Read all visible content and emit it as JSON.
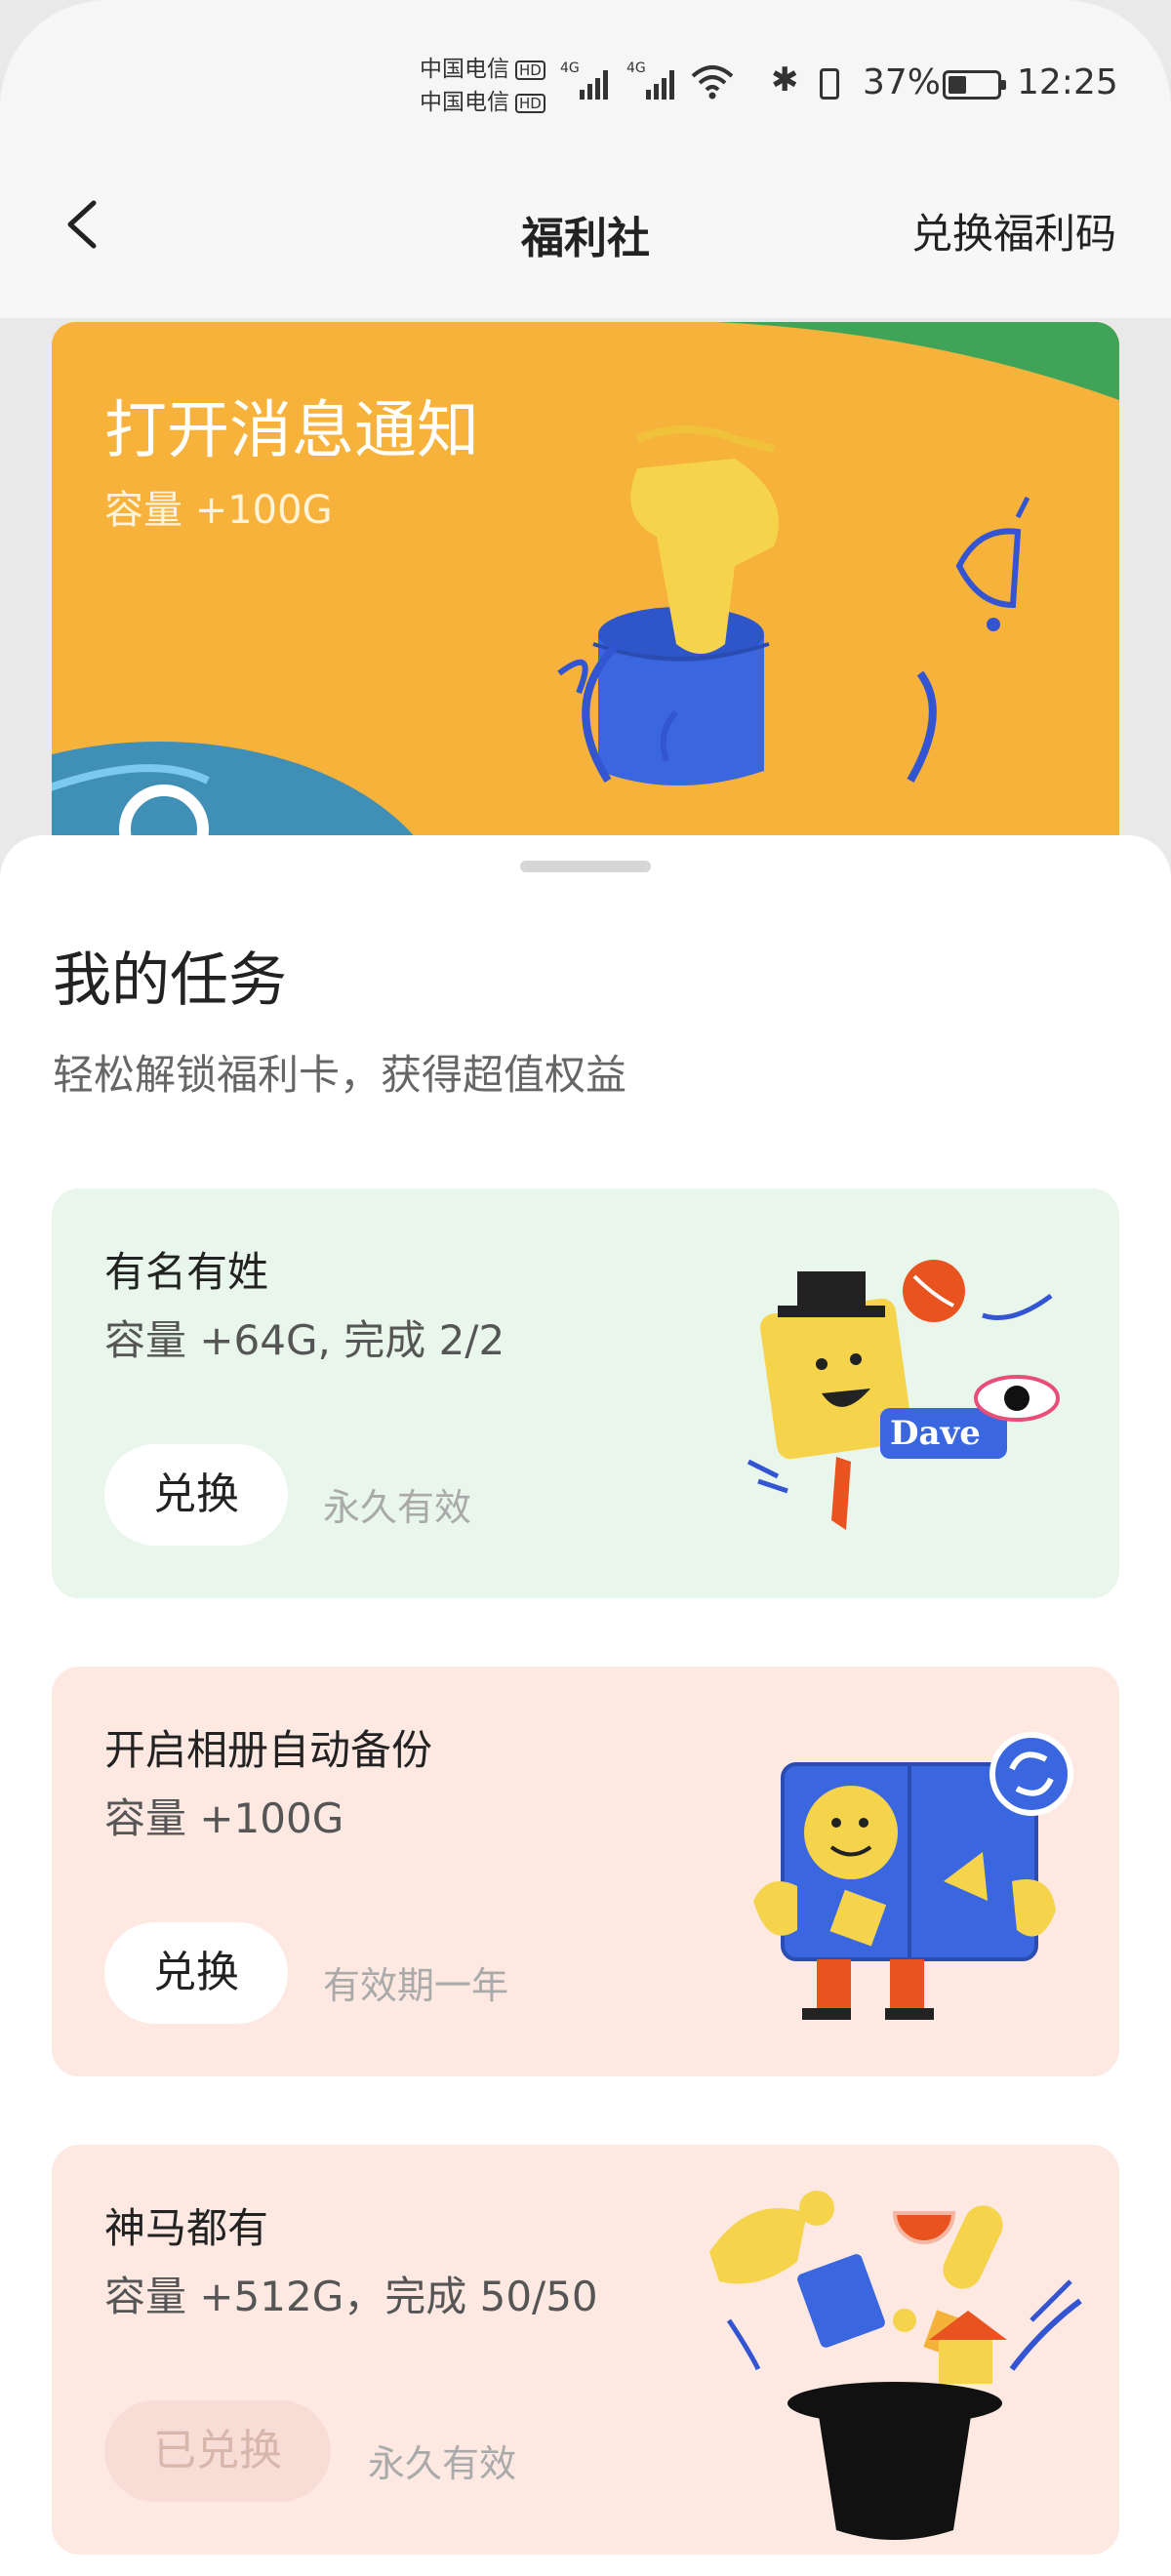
{
  "status_bar": {
    "carrier1": "中国电信",
    "carrier2": "中国电信",
    "hd_badge": "HD",
    "net_type": "4G",
    "battery_percent": "37%",
    "battery_level": 0.37,
    "time": "12:25"
  },
  "header": {
    "title": "福利社",
    "redeem_code": "兑换福利码"
  },
  "banner": {
    "title": "打开消息通知",
    "subtitle": "容量 +100G",
    "colors": {
      "bg": "#f7b23b",
      "accent_green": "#3fa457",
      "accent_blue": "#3a67e0"
    }
  },
  "tasks": {
    "title": "我的任务",
    "subtitle": "轻松解锁福利卡，获得超值权益",
    "items": [
      {
        "title": "有名有姓",
        "desc": "容量 +64G, 完成 2/2",
        "button": "兑换",
        "validity": "永久有效",
        "bg": "#e8f6ec",
        "illus_text": "Dave"
      },
      {
        "title": "开启相册自动备份",
        "desc": "容量 +100G",
        "button": "兑换",
        "validity": "有效期一年",
        "bg": "#fde9e2"
      },
      {
        "title": "神马都有",
        "desc": "容量 +512G，完成 50/50",
        "button": "已兑换",
        "validity": "永久有效",
        "bg": "#fde9e2"
      }
    ]
  }
}
